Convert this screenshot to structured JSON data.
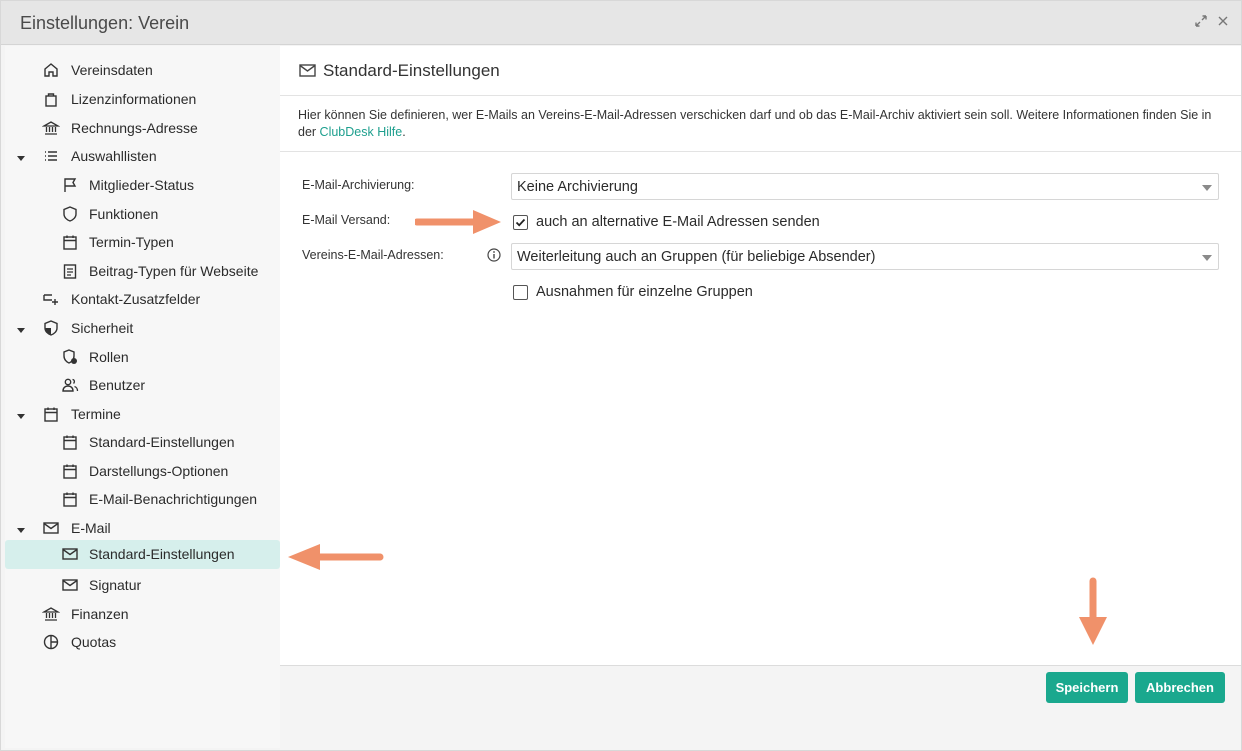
{
  "window": {
    "title": "Einstellungen: Verein"
  },
  "sidebar": {
    "items": [
      {
        "label": "Vereinsdaten",
        "icon": "home-icon"
      },
      {
        "label": "Lizenzinformationen",
        "icon": "bag-icon"
      },
      {
        "label": "Rechnungs-Adresse",
        "icon": "bank-icon"
      },
      {
        "label": "Auswahllisten",
        "icon": "list-icon"
      },
      {
        "label": "Mitglieder-Status",
        "icon": "flag-icon"
      },
      {
        "label": "Funktionen",
        "icon": "shield-outline-icon"
      },
      {
        "label": "Termin-Typen",
        "icon": "calendar-icon"
      },
      {
        "label": "Beitrag-Typen für Webseite",
        "icon": "document-icon"
      },
      {
        "label": "Kontakt-Zusatzfelder",
        "icon": "field-add-icon"
      },
      {
        "label": "Sicherheit",
        "icon": "shield-icon"
      },
      {
        "label": "Rollen",
        "icon": "role-shield-icon"
      },
      {
        "label": "Benutzer",
        "icon": "users-icon"
      },
      {
        "label": "Termine",
        "icon": "calendar-icon"
      },
      {
        "label": "Standard-Einstellungen",
        "icon": "calendar-icon"
      },
      {
        "label": "Darstellungs-Optionen",
        "icon": "calendar-icon"
      },
      {
        "label": "E-Mail-Benachrichtigungen",
        "icon": "calendar-icon"
      },
      {
        "label": "E-Mail",
        "icon": "mail-icon"
      },
      {
        "label": "Standard-Einstellungen",
        "icon": "mail-icon"
      },
      {
        "label": "Signatur",
        "icon": "mail-icon"
      },
      {
        "label": "Finanzen",
        "icon": "bank-icon"
      },
      {
        "label": "Quotas",
        "icon": "pie-icon"
      }
    ]
  },
  "main": {
    "title": "Standard-Einstellungen",
    "description": "Hier können Sie definieren, wer E-Mails an Vereins-E-Mail-Adressen verschicken darf und ob das E-Mail-Archiv aktiviert sein soll. Weitere Informationen finden Sie in der ",
    "help_link": "ClubDesk Hilfe",
    "description_end": ".",
    "fields": {
      "archiving_label": "E-Mail-Archivierung:",
      "archiving_value": "Keine Archivierung",
      "sending_label": "E-Mail Versand:",
      "sending_checkbox": "auch an alternative E-Mail Adressen senden",
      "addresses_label": "Vereins-E-Mail-Adressen:",
      "addresses_value": "Weiterleitung auch an Gruppen (für beliebige Absender)",
      "exceptions_checkbox": "Ausnahmen für einzelne Gruppen"
    },
    "sending_checked": true,
    "exceptions_checked": false
  },
  "footer": {
    "save_label": "Speichern",
    "cancel_label": "Abbrechen"
  },
  "colors": {
    "accent": "#1aa88e",
    "selected": "#d6efec",
    "arrow": "#f0916a"
  }
}
